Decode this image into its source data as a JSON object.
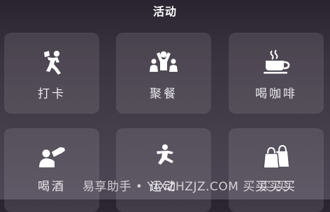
{
  "header": {
    "title": "活动"
  },
  "tiles": [
    {
      "label": "打卡",
      "icon": "check-in-icon"
    },
    {
      "label": "聚餐",
      "icon": "group-gathering-icon"
    },
    {
      "label": "喝咖啡",
      "icon": "coffee-cup-icon"
    },
    {
      "label": "喝酒",
      "icon": "drinking-icon"
    },
    {
      "label": "运动",
      "icon": "exercise-icon"
    },
    {
      "label": "买买买",
      "icon": "shopping-bags-icon"
    }
  ],
  "watermark": {
    "text": "易享助手 • YIXZHZJZ.COM 买 买 买"
  }
}
